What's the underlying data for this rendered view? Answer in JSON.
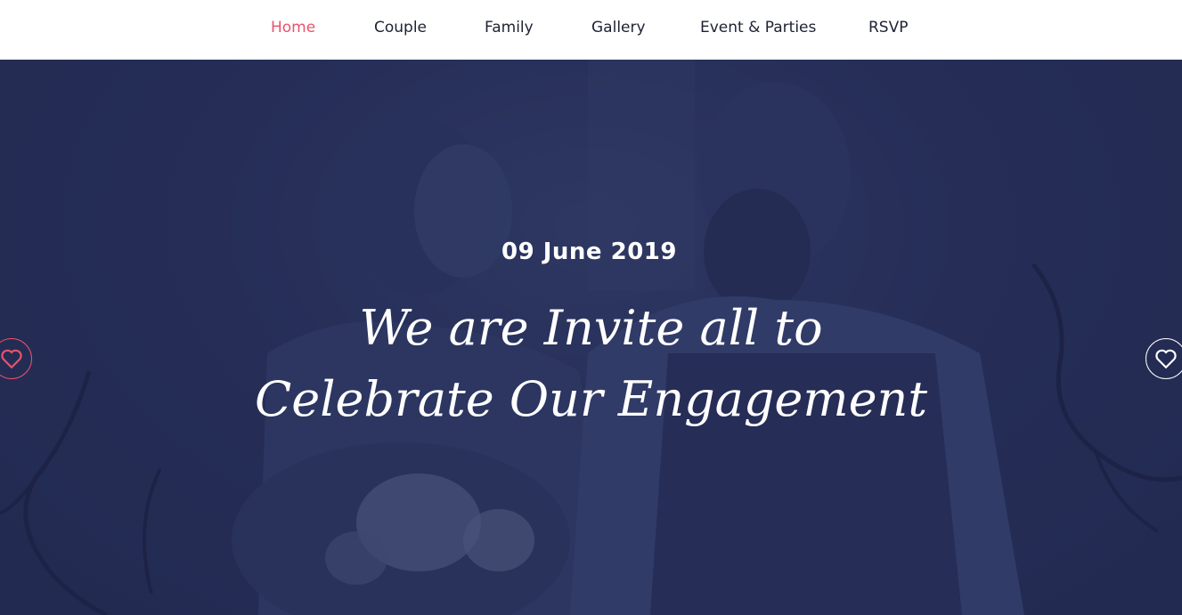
{
  "nav": {
    "items": [
      {
        "label": "Home",
        "active": true
      },
      {
        "label": "Couple",
        "active": false
      },
      {
        "label": "Family",
        "active": false
      },
      {
        "label": "Gallery",
        "active": false
      },
      {
        "label": "Event & Parties",
        "active": false
      },
      {
        "label": "RSVP",
        "active": false
      }
    ]
  },
  "hero": {
    "date": "09 June 2019",
    "headline_line1": "We are Invite all to",
    "headline_line2": "Celebrate Our Engagement",
    "prev_icon": "heart-icon",
    "next_icon": "heart-icon"
  },
  "colors": {
    "accent": "#e8536a",
    "overlay": "#24305a",
    "nav_text": "#1e2233"
  }
}
